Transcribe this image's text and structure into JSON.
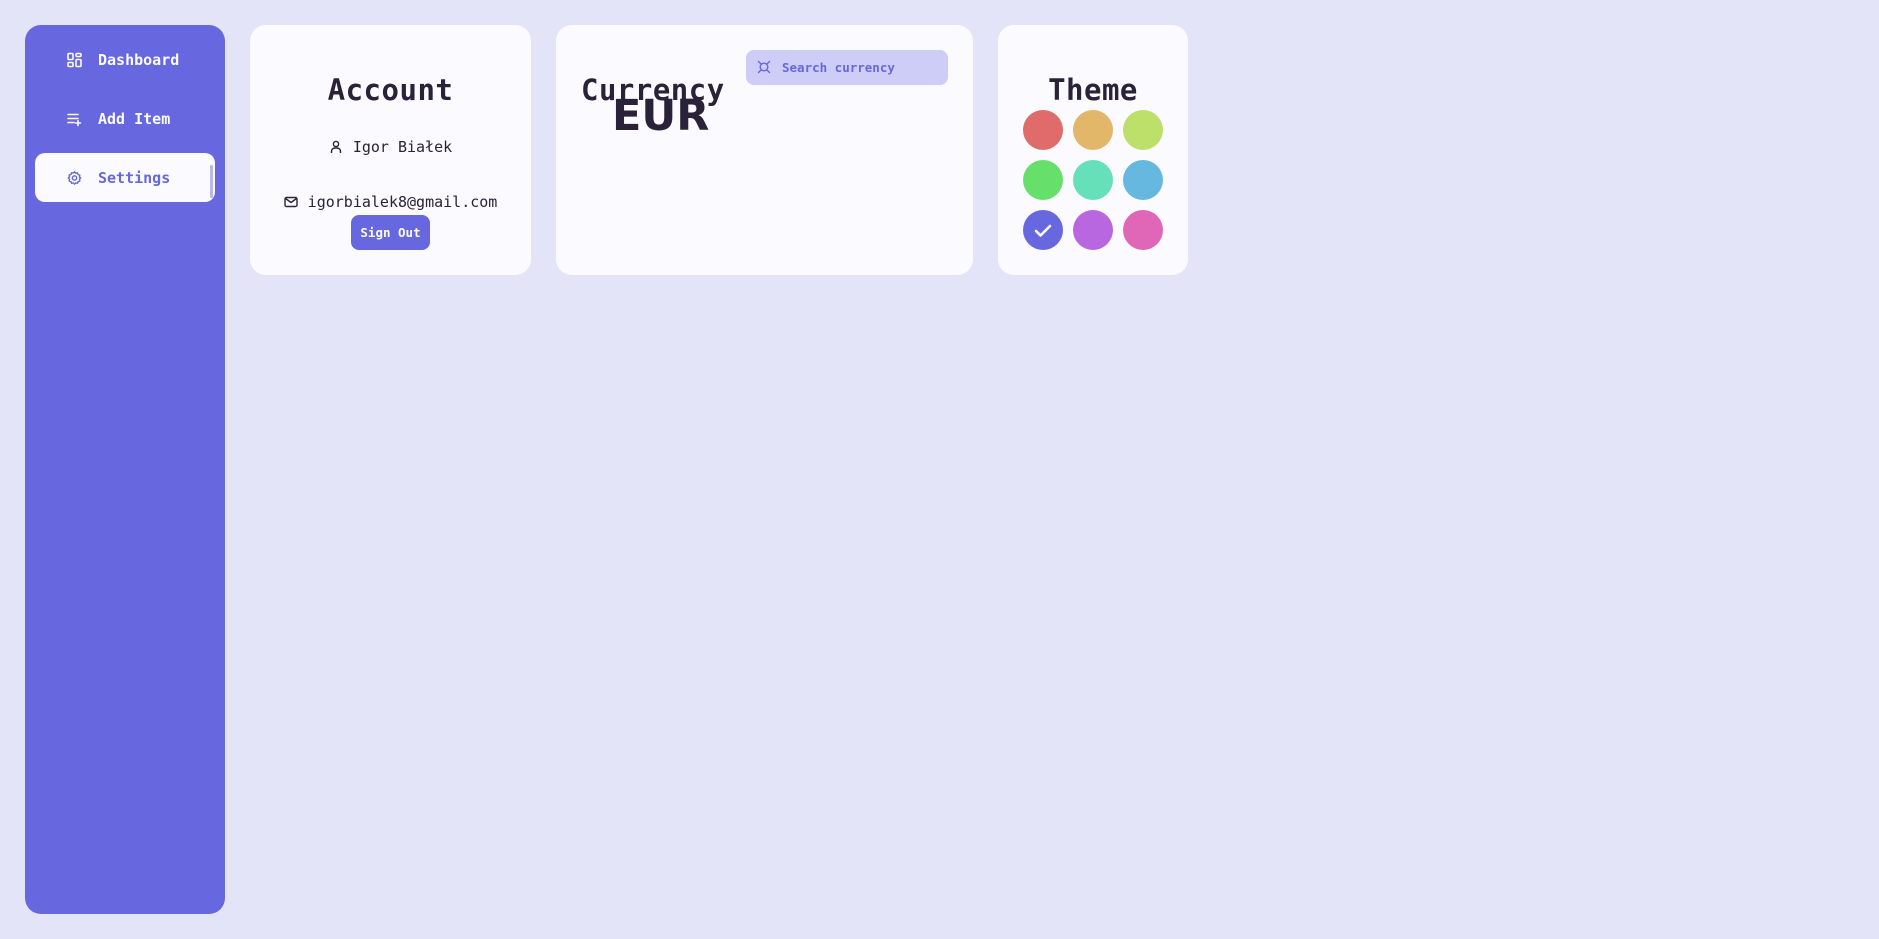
{
  "sidebar": {
    "items": [
      {
        "label": "Dashboard",
        "icon": "dashboard-icon",
        "active": false
      },
      {
        "label": "Add Item",
        "icon": "playlist-add-icon",
        "active": false
      },
      {
        "label": "Settings",
        "icon": "gear-icon",
        "active": true
      }
    ]
  },
  "account": {
    "title": "Account",
    "name": "Igor Białek",
    "email": "igorbialek8@gmail.com",
    "sign_out_label": "Sign Out"
  },
  "currency": {
    "title": "Currency",
    "selected": "EUR",
    "search": {
      "placeholder": "Search currency",
      "value": "",
      "icon": "currency-icon"
    }
  },
  "theme": {
    "title": "Theme",
    "swatches": [
      {
        "name": "red",
        "color": "#e06b6b",
        "selected": false
      },
      {
        "name": "orange",
        "color": "#e2b76a",
        "selected": false
      },
      {
        "name": "lime",
        "color": "#bce06a",
        "selected": false
      },
      {
        "name": "green",
        "color": "#66e06a",
        "selected": false
      },
      {
        "name": "teal",
        "color": "#66e0b8",
        "selected": false
      },
      {
        "name": "blue",
        "color": "#66b8e0",
        "selected": false
      },
      {
        "name": "indigo",
        "color": "#6767e0",
        "selected": true
      },
      {
        "name": "purple",
        "color": "#b867e0",
        "selected": false
      },
      {
        "name": "pink",
        "color": "#e067b8",
        "selected": false
      }
    ]
  },
  "colors": {
    "accent": "#6767df",
    "background": "#e3e4f8",
    "card": "#fbfbff",
    "text": "#2a2238",
    "search_bg": "#cdcdf7"
  }
}
